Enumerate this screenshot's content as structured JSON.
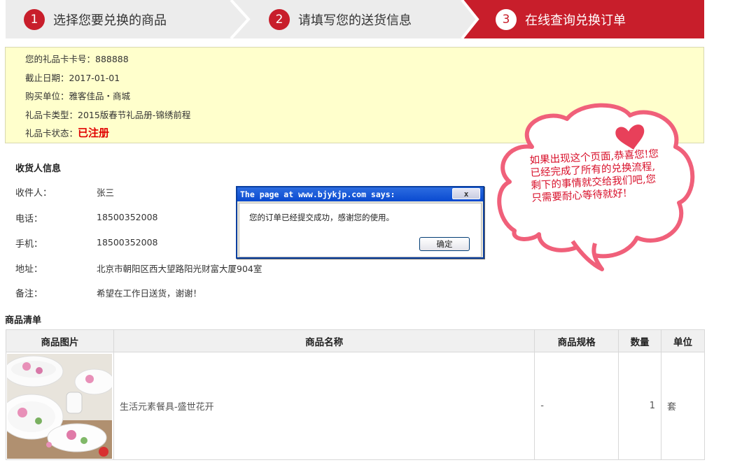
{
  "steps": [
    {
      "num": "1",
      "label": "选择您要兑换的商品"
    },
    {
      "num": "2",
      "label": "请填写您的送货信息"
    },
    {
      "num": "3",
      "label": "在线查询兑换订单"
    }
  ],
  "card": {
    "number": "您的礼品卡卡号：888888",
    "deadline": "截止日期：2017-01-01",
    "buyer": "购买单位：雅客佳品・商城",
    "type": "礼品卡类型：2015版春节礼品册-锦绣前程",
    "status_label": "礼品卡状态：",
    "status_value": "已注册"
  },
  "receiver": {
    "title": "收货人信息",
    "name_label": "收件人：",
    "name": "张三",
    "phone_label": "电话：",
    "phone": "18500352008",
    "mobile_label": "手机：",
    "mobile": "18500352008",
    "address_label": "地址：",
    "address": "北京市朝阳区西大望路阳光财富大厦904室",
    "remark_label": "备注：",
    "remark": "希望在工作日送货，谢谢！"
  },
  "goods": {
    "title": "商品清单",
    "headers": [
      "商品图片",
      "商品名称",
      "商品规格",
      "数量",
      "单位"
    ],
    "rows": [
      {
        "name": "生活元素餐具-盛世花开",
        "spec": "-",
        "qty": "1",
        "unit": "套"
      }
    ]
  },
  "dialog": {
    "title": "The page at www.bjykjp.com says:",
    "close": "x",
    "message": "您的订单已经提交成功，感谢您的使用。",
    "ok": "确定"
  },
  "bubble": {
    "text": "如果出现这个页面,恭喜您!您已经完成了所有的兑换流程,剩下的事情就交给我们吧,您只需要耐心等待就好!"
  },
  "colors": {
    "accent": "#c81e2b",
    "card_bg": "#ffffcc",
    "bubble_stroke": "#f0607a",
    "heart": "#e8405a"
  }
}
